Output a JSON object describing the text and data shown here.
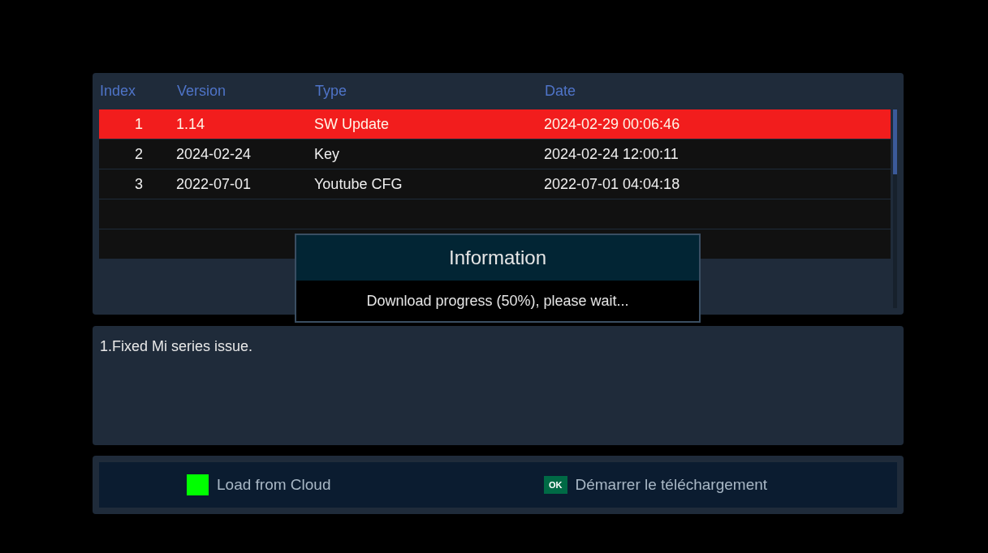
{
  "table": {
    "columns": [
      "Index",
      "Version",
      "Type",
      "Date"
    ],
    "rows": [
      {
        "index": "1",
        "version": "1.14",
        "type": "SW Update",
        "date": "2024-02-29 00:06:46",
        "selected": true
      },
      {
        "index": "2",
        "version": "2024-02-24",
        "type": "Key",
        "date": "2024-02-24 12:00:11",
        "selected": false
      },
      {
        "index": "3",
        "version": "2022-07-01",
        "type": "Youtube CFG",
        "date": "2022-07-01 04:04:18",
        "selected": false
      }
    ]
  },
  "dialog": {
    "title": "Information",
    "message": "Download progress (50%), please wait..."
  },
  "description": "1.Fixed Mi series issue.",
  "hints": [
    {
      "kind": "color-key",
      "color": "#00ff00",
      "label": "Load from Cloud"
    },
    {
      "kind": "ok-key",
      "key": "OK",
      "label": "Démarrer le téléchargement"
    }
  ]
}
